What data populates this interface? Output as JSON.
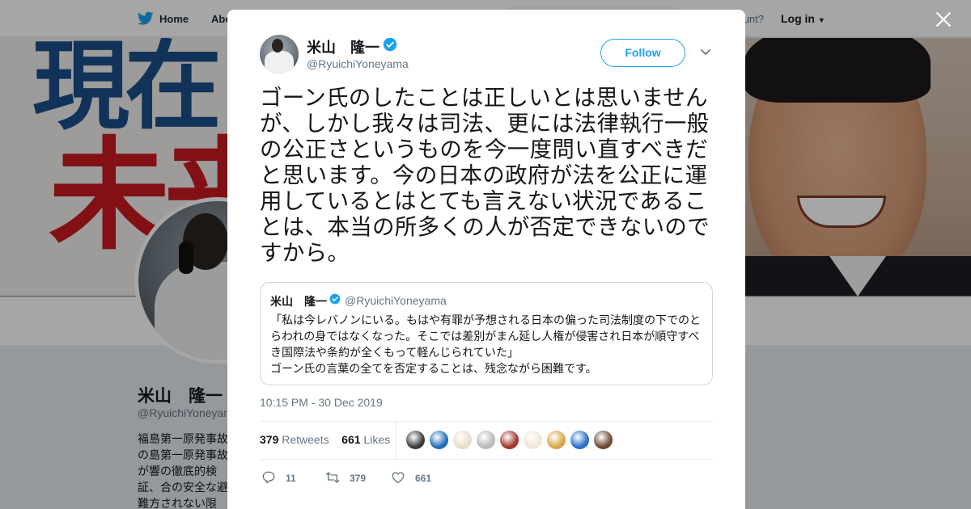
{
  "nav": {
    "home": "Home",
    "about": "Abo",
    "account_prompt": "count?",
    "login": "Log in"
  },
  "banner": {
    "line1": "現在",
    "line2": "未来"
  },
  "profile": {
    "name": "米山　隆一",
    "handle": "@RyuichiYoneyama",
    "bio": "福島第一原発事故の島第一原発事故が響の徹底的検証、合の安全な避難方されない限り、原"
  },
  "tweet": {
    "author_name": "米山　隆一",
    "author_handle": "@RyuichiYoneyama",
    "follow_label": "Follow",
    "text": "ゴーン氏のしたことは正しいとは思いませんが、しかし我々は司法、更には法律執行一般の公正さというものを今一度問い直すべきだと思います。今の日本の政府が法を公正に運用しているとはとても言えない状況であることは、本当の所多くの人が否定できないのですから。",
    "timestamp": "10:15 PM - 30 Dec 2019",
    "quote": {
      "author_name": "米山　隆一",
      "author_handle": "@RyuichiYoneyama",
      "text": "「私は今レバノンにいる。もはや有罪が予想される日本の偏った司法制度の下でのとらわれの身ではなくなった。そこでは差別がまん延し人権が侵害され日本が順守すべき国際法や条約が全くもって軽んじられていた」\nゴーン氏の言葉の全てを否定することは、残念ながら困難です。"
    },
    "stats": {
      "retweets_count": "379",
      "retweets_label": "Retweets",
      "likes_count": "661",
      "likes_label": "Likes"
    },
    "likers": [
      "#3a3a3a",
      "#1f6fb8",
      "#e7dcc9",
      "#b9b9b9",
      "#a3362c",
      "#f1e6d8",
      "#d8a64a",
      "#2b6fc9",
      "#6b4a32"
    ],
    "actions": {
      "replies": "11",
      "retweets": "379",
      "likes": "661"
    }
  },
  "colors": {
    "accent": "#1da1f2",
    "verified": "#1da1f2",
    "text_secondary": "#657786"
  }
}
